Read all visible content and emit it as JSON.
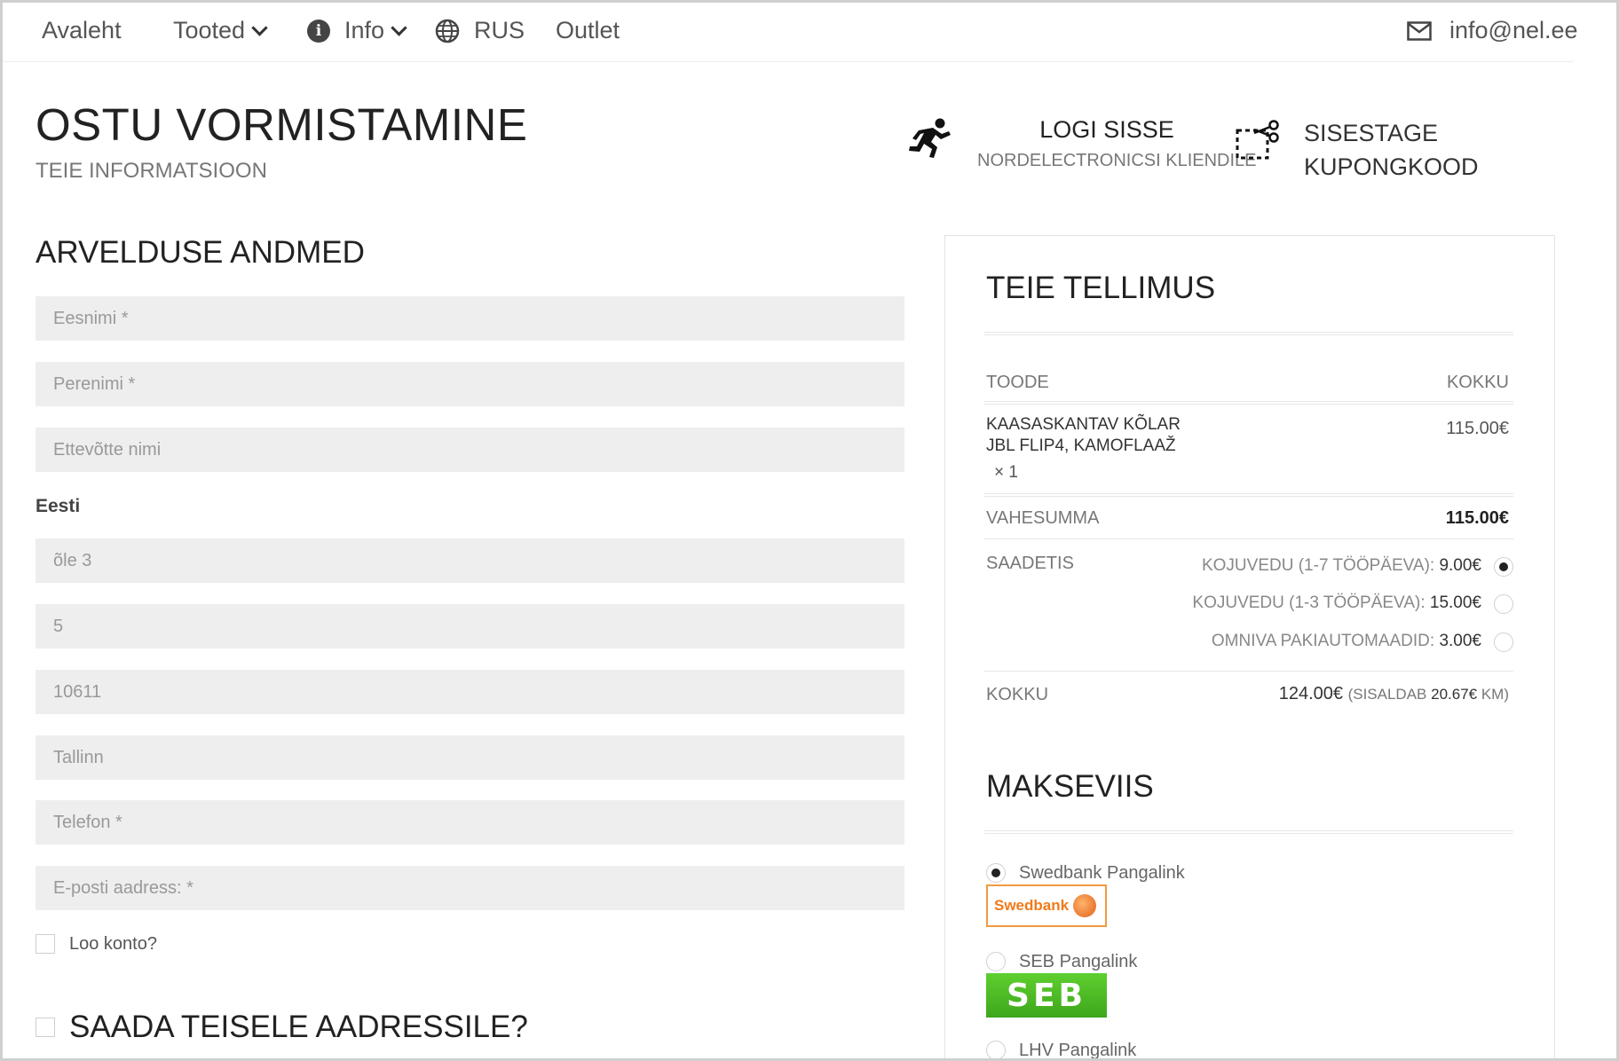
{
  "nav": {
    "home": "Avaleht",
    "products": "Tooted",
    "info": "Info",
    "lang": "RUS",
    "outlet": "Outlet",
    "email": "info@nel.ee"
  },
  "header": {
    "title": "OSTU VORMISTAMINE",
    "subtitle": "TEIE INFORMATSIOON",
    "login_title": "LOGI SISSE",
    "login_sub": "NORDELECTRONICSI KLIENDILE",
    "coupon_line1": "SISESTAGE",
    "coupon_line2": "KUPONGKOOD"
  },
  "billing": {
    "title": "ARVELDUSE ANDMED",
    "first_name_ph": "Eesnimi *",
    "last_name_ph": "Perenimi *",
    "company_ph": "Ettevõtte nimi",
    "country": "Eesti",
    "address1": "õle 3",
    "address2": "5",
    "postcode": "10611",
    "city": "Tallinn",
    "phone_ph": "Telefon *",
    "email_ph": "E-posti aadress: *",
    "create_account": "Loo konto?",
    "ship_other": "SAADA TEISELE AADRESSILE?"
  },
  "order": {
    "title": "TEIE TELLIMUS",
    "col_product": "TOODE",
    "col_total": "KOKKU",
    "item_line1": "KAASASKANTAV KÕLAR",
    "item_line2": "JBL FLIP4, KAMOFLAAŽ",
    "item_qty": "× 1",
    "item_price": "115.00€",
    "subtotal_label": "VAHESUMMA",
    "subtotal": "115.00€",
    "shipping_label": "SAADETIS",
    "ship1_label": "KOJUVEDU (1-7 TÖÖPÄEVA): ",
    "ship1_price": "9.00€",
    "ship2_label": "KOJUVEDU (1-3 TÖÖPÄEVA): ",
    "ship2_price": "15.00€",
    "ship3_label": "OMNIVA PAKIAUTOMAADID: ",
    "ship3_price": "3.00€",
    "total_label": "KOKKU",
    "total": "124.00€",
    "tax_prefix": "(SISALDAB ",
    "tax_amount": "20.67€",
    "tax_suffix": " KM)"
  },
  "payment": {
    "title": "MAKSEVIIS",
    "swedbank": "Swedbank Pangalink",
    "swedbank_logo": "Swedbank",
    "seb": "SEB Pangalink",
    "seb_logo": "SEB",
    "lhv": "LHV Pangalink"
  }
}
